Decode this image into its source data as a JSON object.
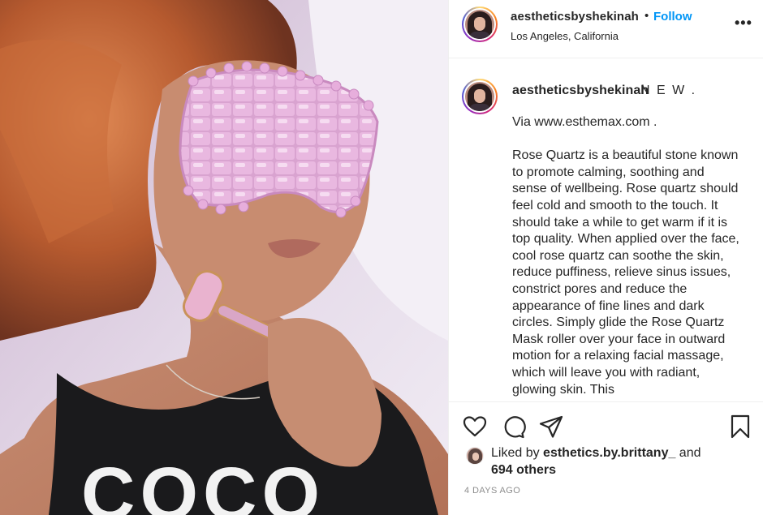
{
  "photo": {
    "icon": "post-photo-woman-rose-quartz-mask",
    "shirt_text": "COCO"
  },
  "header": {
    "username": "aestheticsbyshekinah",
    "separator": "•",
    "follow_label": "Follow",
    "location": "Los Angeles, California",
    "more_label": "•••"
  },
  "caption": {
    "username": "aestheticsbyshekinah",
    "head": "N E W .",
    "body": "Via www.esthemax.com .\n\nRose Quartz is a beautiful stone known to promote calming, soothing and sense of wellbeing. Rose quartz should feel cold and smooth to the touch. It should take a while to get warm if it is top quality. When applied over the face, cool rose quartz can soothe the skin, reduce puffiness, relieve sinus issues, constrict pores and reduce the appearance of fine lines and dark circles. Simply glide the Rose Quartz Mask roller over your face in outward motion for a relaxing facial massage, which will leave you with radiant, glowing skin. This"
  },
  "actions": {
    "like_icon": "heart-outline-icon",
    "comment_icon": "comment-bubble-icon",
    "share_icon": "paper-plane-icon",
    "save_icon": "bookmark-icon"
  },
  "likes": {
    "prefix": "Liked by ",
    "user": "esthetics.by.brittany_",
    "and": " and",
    "others": "694 others"
  },
  "date": "4 DAYS AGO",
  "colors": {
    "follow": "#0095f6",
    "text": "#262626",
    "muted": "#8e8e8e",
    "border": "#efefef"
  }
}
